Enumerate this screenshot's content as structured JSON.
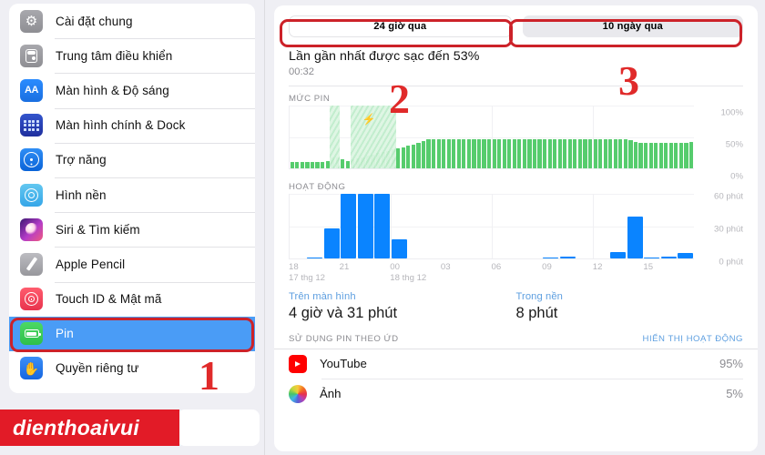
{
  "sidebar": {
    "items": [
      {
        "label": "Cài đặt chung",
        "icon": "gear-icon",
        "selected": false
      },
      {
        "label": "Trung tâm điều khiển",
        "icon": "control-center-icon",
        "selected": false
      },
      {
        "label": "Màn hình & Độ sáng",
        "icon": "display-aa-icon",
        "selected": false
      },
      {
        "label": "Màn hình chính & Dock",
        "icon": "home-screen-icon",
        "selected": false
      },
      {
        "label": "Trợ năng",
        "icon": "accessibility-icon",
        "selected": false
      },
      {
        "label": "Hình nền",
        "icon": "wallpaper-icon",
        "selected": false
      },
      {
        "label": "Siri & Tìm kiếm",
        "icon": "siri-icon",
        "selected": false
      },
      {
        "label": "Apple Pencil",
        "icon": "pencil-icon",
        "selected": false
      },
      {
        "label": "Touch ID & Mật mã",
        "icon": "fingerprint-icon",
        "selected": false
      },
      {
        "label": "Pin",
        "icon": "battery-icon",
        "selected": true
      },
      {
        "label": "Quyền riêng tư",
        "icon": "privacy-hand-icon",
        "selected": false
      }
    ]
  },
  "main": {
    "segments": [
      {
        "label": "24 giờ qua",
        "selected": true
      },
      {
        "label": "10 ngày qua",
        "selected": false
      }
    ],
    "last_charge_title": "Lần gần nhất được sạc đến 53%",
    "last_charge_time": "00:32",
    "battery_section_title": "MỨC PIN",
    "activity_section_title": "HOẠT ĐỘNG",
    "usage": [
      {
        "caption": "Trên màn hình",
        "value": "4 giờ và 31 phút"
      },
      {
        "caption": "Trong nền",
        "value": "8 phút"
      }
    ],
    "app_list_title": "SỬ DỤNG PIN THEO ỨD",
    "app_list_action": "HIỂN THỊ HOẠT ĐỘNG",
    "apps": [
      {
        "name": "YouTube",
        "pct": "95%",
        "icon": "youtube-icon"
      },
      {
        "name": "Ảnh",
        "pct": "5%",
        "icon": "photos-icon"
      }
    ]
  },
  "annotations": {
    "n1": "1",
    "n2": "2",
    "n3": "3",
    "watermark": "dienthoaivui",
    "accent": "#cc2229"
  },
  "chart_data": [
    {
      "type": "bar",
      "title": "MỨC PIN",
      "ylabel": "",
      "xlabel": "",
      "ylim": [
        0,
        100
      ],
      "ytick_labels": [
        "100%",
        "50%",
        "0%"
      ],
      "ytick_values": [
        100,
        50,
        0
      ],
      "unit": "%",
      "grid": true,
      "legend": null,
      "bar_color": "#56cc6d",
      "charging_band_color": "#ddf5e3",
      "charging_intervals": [
        [
          8,
          10
        ],
        [
          12,
          21
        ]
      ],
      "categories": [
        "18",
        "19",
        "20",
        "21",
        "22",
        "23",
        "00",
        "01",
        "02",
        "03",
        "04",
        "05",
        "06",
        "07",
        "08",
        "09",
        "10",
        "11",
        "12",
        "13",
        "14",
        "15",
        "16",
        "17"
      ],
      "values": [
        10,
        10,
        10,
        10,
        10,
        10,
        10,
        11,
        17,
        18,
        14,
        12,
        14,
        16,
        18,
        20,
        22,
        24,
        26,
        28,
        30,
        32,
        34,
        36,
        38,
        40,
        44,
        46,
        46,
        46,
        46,
        46,
        46,
        46,
        46,
        46,
        46,
        46,
        46,
        46,
        46,
        46,
        46,
        46,
        46,
        46,
        46,
        46,
        46,
        46,
        46,
        46,
        46,
        46,
        46,
        46,
        46,
        46,
        46,
        46,
        46,
        46,
        46,
        46,
        46,
        46,
        46,
        45,
        42,
        41,
        41,
        41,
        41,
        41,
        41,
        41,
        41,
        41,
        41,
        42
      ]
    },
    {
      "type": "bar",
      "title": "HOẠT ĐỘNG",
      "ylabel": "",
      "xlabel": "",
      "ylim": [
        0,
        60
      ],
      "unit": "phút",
      "ytick_labels": [
        "60 phút",
        "30 phút",
        "0 phút"
      ],
      "ytick_values": [
        60,
        30,
        0
      ],
      "grid": true,
      "bar_color": "#0a84ff",
      "xtick_labels": [
        "18",
        "21",
        "00",
        "03",
        "06",
        "09",
        "12",
        "15"
      ],
      "xsub_labels": [
        {
          "at": "18",
          "text": "17 thg 12"
        },
        {
          "at": "00",
          "text": "18 thg 12"
        }
      ],
      "categories": [
        "18",
        "19",
        "20",
        "21",
        "22",
        "23",
        "00",
        "01",
        "02",
        "03",
        "04",
        "05",
        "06",
        "07",
        "08",
        "09",
        "10",
        "11",
        "12",
        "13",
        "14",
        "15",
        "16",
        "17"
      ],
      "values": [
        0,
        1,
        28,
        60,
        60,
        60,
        18,
        0,
        0,
        0,
        0,
        0,
        0,
        0,
        0,
        1,
        2,
        0,
        0,
        6,
        39,
        1,
        2,
        5
      ]
    }
  ]
}
